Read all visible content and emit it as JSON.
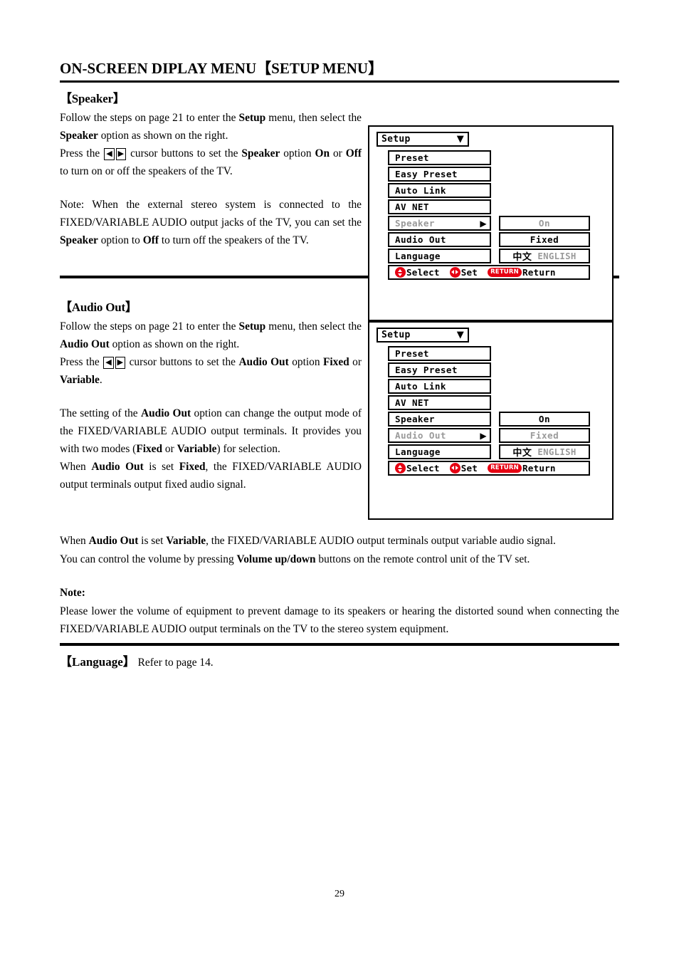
{
  "document": {
    "title": "ON-SCREEN DIPLAY MENU【SETUP MENU】",
    "page_number": "29"
  },
  "speaker_section": {
    "heading": "【Speaker】",
    "para1_a": "Follow the steps on page 21 to enter the ",
    "para1_b": "Setup",
    "para1_c": " menu, then select the ",
    "para1_d": "Speaker",
    "para1_e": " option as shown on the right.",
    "para2_a": "Press the ",
    "para2_left_key": "◀",
    "para2_right_key": "▶",
    "para2_b": " cursor buttons to set the ",
    "para2_c": "Speaker",
    "para2_d": " option ",
    "para2_e": "On",
    "para2_f": " or ",
    "para2_g": "Off",
    "para2_h": " to turn on or off the speakers of the TV.",
    "note_a": "Note: When the external stereo system is connected to the FIXED/VARIABLE AUDIO output jacks of the TV, you can set the ",
    "note_b": "Speaker",
    "note_c": " option to ",
    "note_d": "Off",
    "note_e": " to turn off the speakers of the TV."
  },
  "audio_out_section": {
    "heading": "【Audio Out】",
    "para1_a": "Follow the steps on page 21 to enter the ",
    "para1_b": "Setup",
    "para1_c": " menu, then select the ",
    "para1_d": "Audio Out",
    "para1_e": " option as shown on the right.",
    "para2_a": "Press the ",
    "para2_left_key": "◀",
    "para2_right_key": "▶",
    "para2_b": " cursor buttons to set the ",
    "para2_c": "Audio Out",
    "para2_d": " option ",
    "para2_e": "Fixed",
    "para2_f": " or ",
    "para2_g": "Variable",
    "para2_h": ".",
    "para3_a": "The setting of the ",
    "para3_b": "Audio Out",
    "para3_c": " option can change the output mode of the FIXED/VARIABLE AUDIO output terminals. It provides you with two modes (",
    "para3_d": "Fixed",
    "para3_e": " or ",
    "para3_f": "Variable",
    "para3_g": ") for selection.",
    "para4_a": "When ",
    "para4_b": "Audio Out",
    "para4_c": " is set ",
    "para4_d": "Fixed",
    "para4_e": ", the FIXED/VARIABLE AUDIO output terminals output fixed audio signal.",
    "para5_a": "When ",
    "para5_b": "Audio Out",
    "para5_c": " is set ",
    "para5_d": "Variable",
    "para5_e": ", the FIXED/VARIABLE AUDIO output terminals output variable audio signal.",
    "para6_a": "You can control the volume by pressing ",
    "para6_b": "Volume up/down",
    "para6_c": " buttons on the remote control unit of the TV set."
  },
  "note_block": {
    "label": "Note:",
    "text": "Please lower the volume of equipment to prevent damage to its speakers or hearing the distorted sound when connecting the FIXED/VARIABLE AUDIO output terminals on the TV to the stereo system equipment."
  },
  "language_section": {
    "heading": "【Language】",
    "text": "Refer to page 14."
  },
  "osd_common": {
    "title": "Setup",
    "caret": "▼",
    "right_arrow": "▶",
    "hints": {
      "select": "Select",
      "set": "Set",
      "return_badge": "RETURN",
      "return": "Return"
    },
    "language_value_cn": "中文",
    "language_value_en": "ENGLISH",
    "colors": {
      "accent_red": "#e60012",
      "dim_gray": "#9a9a9a",
      "border": "#000000"
    }
  },
  "osd_panel_speaker": {
    "rows": [
      {
        "label": "Preset",
        "value": "",
        "selected": false,
        "has_value": false
      },
      {
        "label": "Easy Preset",
        "value": "",
        "selected": false,
        "has_value": false
      },
      {
        "label": "Auto Link",
        "value": "",
        "selected": false,
        "has_value": false
      },
      {
        "label": "AV NET",
        "value": "",
        "selected": false,
        "has_value": false
      },
      {
        "label": "Speaker",
        "value": "On",
        "selected": true,
        "has_value": true
      },
      {
        "label": "Audio Out",
        "value": "Fixed",
        "selected": false,
        "has_value": true
      },
      {
        "label": "Language",
        "value": "中文 ENGLISH",
        "selected": false,
        "has_value": true
      }
    ]
  },
  "osd_panel_audio_out": {
    "rows": [
      {
        "label": "Preset",
        "value": "",
        "selected": false,
        "has_value": false
      },
      {
        "label": "Easy Preset",
        "value": "",
        "selected": false,
        "has_value": false
      },
      {
        "label": "Auto Link",
        "value": "",
        "selected": false,
        "has_value": false
      },
      {
        "label": "AV NET",
        "value": "",
        "selected": false,
        "has_value": false
      },
      {
        "label": "Speaker",
        "value": "On",
        "selected": false,
        "has_value": true
      },
      {
        "label": "Audio Out",
        "value": "Fixed",
        "selected": true,
        "has_value": true
      },
      {
        "label": "Language",
        "value": "中文 ENGLISH",
        "selected": false,
        "has_value": true
      }
    ]
  }
}
